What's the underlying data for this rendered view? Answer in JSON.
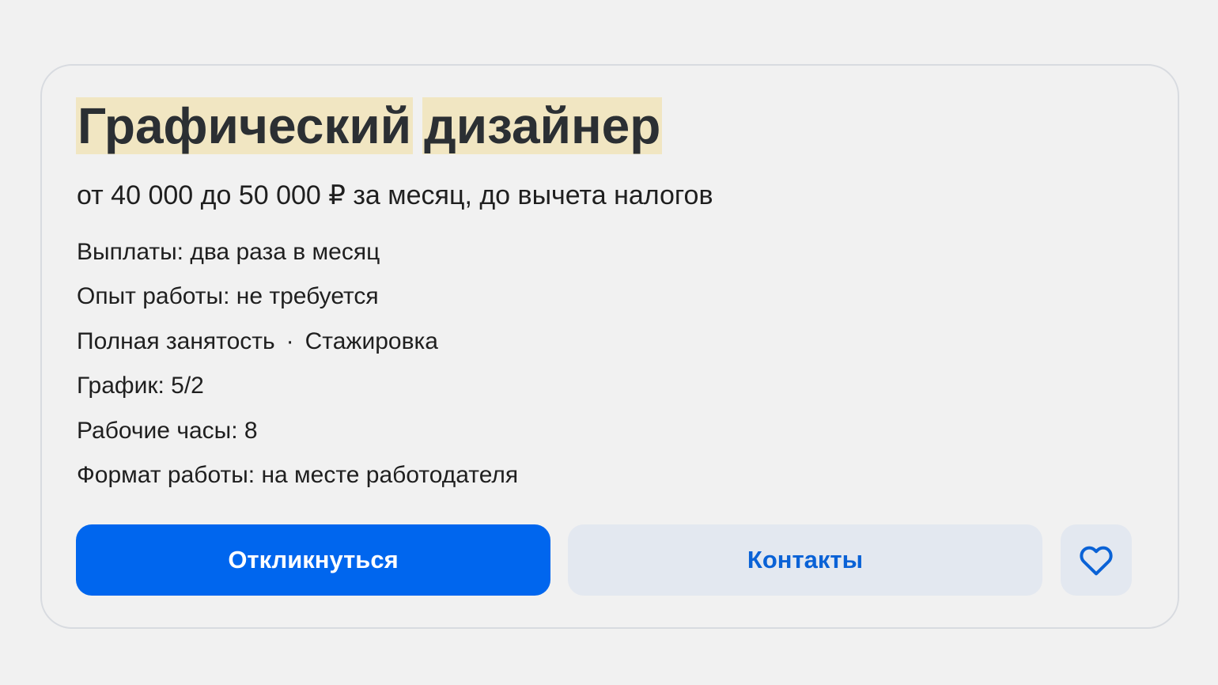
{
  "vacancy": {
    "title_words": [
      "Графический",
      "дизайнер"
    ],
    "salary": "от 40 000 до 50 000 ₽ за месяц, до вычета налогов",
    "payments": "Выплаты: два раза в месяц",
    "experience": "Опыт работы: не требуется",
    "employment": "Полная занятость",
    "separator": "·",
    "internship": "Стажировка",
    "schedule": "График: 5/2",
    "hours": "Рабочие часы: 8",
    "work_format": "Формат работы: на месте работодателя"
  },
  "actions": {
    "respond_label": "Откликнуться",
    "contacts_label": "Контакты",
    "favorite_icon": "heart-icon"
  },
  "colors": {
    "primary": "#0066ee",
    "secondary_bg": "#e3e8f0",
    "secondary_text": "#0a62d6",
    "highlight": "#f1e6c2"
  }
}
